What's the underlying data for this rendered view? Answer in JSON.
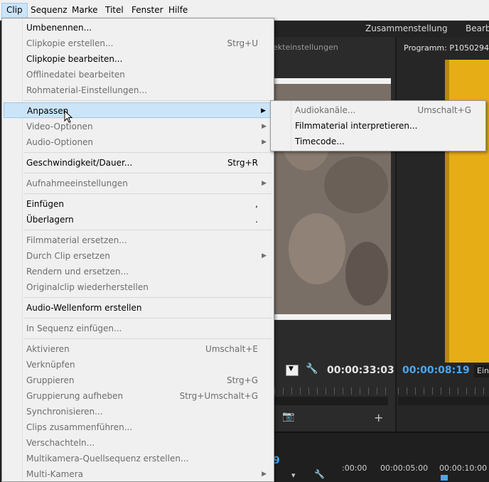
{
  "menubar": {
    "items": [
      {
        "label": "Clip",
        "active": true
      },
      {
        "label": "Sequenz"
      },
      {
        "label": "Marke"
      },
      {
        "label": "Titel"
      },
      {
        "label": "Fenster"
      },
      {
        "label": "Hilfe"
      }
    ]
  },
  "background": {
    "workspace_tabs": [
      "Zusammenstellung",
      "Bearbe"
    ],
    "source_panel_title": "ekteinstellungen",
    "program_panel_title": "Programm: P1050294",
    "source_timecode": "00:00:33:03",
    "program_timecode": "00:00:08:19",
    "program_fit_label": "Ein",
    "timeline_digit": "9",
    "timeline_ruler": [
      ":00:00",
      "00:00:05:00",
      "00:00:10:00"
    ]
  },
  "clip_menu": {
    "items": [
      {
        "label": "Umbenennen...",
        "shortcut": "",
        "enabled": true
      },
      {
        "label": "Clipkopie erstellen...",
        "shortcut": "Strg+U",
        "enabled": false
      },
      {
        "label": "Clipkopie bearbeiten...",
        "shortcut": "",
        "enabled": true
      },
      {
        "label": "Offlinedatei bearbeiten",
        "shortcut": "",
        "enabled": false
      },
      {
        "label": "Rohmaterial-Einstellungen...",
        "shortcut": "",
        "enabled": false
      },
      {
        "label": "Anpassen",
        "shortcut": "",
        "enabled": true,
        "submenu": true,
        "highlighted": true
      },
      {
        "label": "Video-Optionen",
        "shortcut": "",
        "enabled": false,
        "submenu": true
      },
      {
        "label": "Audio-Optionen",
        "shortcut": "",
        "enabled": false,
        "submenu": true
      },
      {
        "label": "Geschwindigkeit/Dauer...",
        "shortcut": "Strg+R",
        "enabled": true
      },
      {
        "label": "Aufnahmeeinstellungen",
        "shortcut": "",
        "enabled": false,
        "submenu": true
      },
      {
        "label": "Einfügen",
        "shortcut": ",",
        "enabled": true
      },
      {
        "label": "Überlagern",
        "shortcut": ".",
        "enabled": true
      },
      {
        "label": "Filmmaterial ersetzen...",
        "shortcut": "",
        "enabled": false
      },
      {
        "label": "Durch Clip ersetzen",
        "shortcut": "",
        "enabled": false,
        "submenu": true
      },
      {
        "label": "Rendern und ersetzen...",
        "shortcut": "",
        "enabled": false
      },
      {
        "label": "Originalclip wiederherstellen",
        "shortcut": "",
        "enabled": false
      },
      {
        "label": "Audio-Wellenform erstellen",
        "shortcut": "",
        "enabled": true
      },
      {
        "label": "In Sequenz einfügen...",
        "shortcut": "",
        "enabled": false
      },
      {
        "label": "Aktivieren",
        "shortcut": "Umschalt+E",
        "enabled": false
      },
      {
        "label": "Verknüpfen",
        "shortcut": "",
        "enabled": false
      },
      {
        "label": "Gruppieren",
        "shortcut": "Strg+G",
        "enabled": false
      },
      {
        "label": "Gruppierung aufheben",
        "shortcut": "Strg+Umschalt+G",
        "enabled": false
      },
      {
        "label": "Synchronisieren...",
        "shortcut": "",
        "enabled": false
      },
      {
        "label": "Clips zusammenführen...",
        "shortcut": "",
        "enabled": false
      },
      {
        "label": "Verschachteln...",
        "shortcut": "",
        "enabled": false
      },
      {
        "label": "Multikamera-Quellsequenz erstellen...",
        "shortcut": "",
        "enabled": false
      },
      {
        "label": "Multi-Kamera",
        "shortcut": "",
        "enabled": false,
        "submenu": true
      }
    ]
  },
  "submenu_anpassen": {
    "items": [
      {
        "label": "Audiokanäle...",
        "shortcut": "Umschalt+G",
        "enabled": false
      },
      {
        "label": "Filmmaterial interpretieren...",
        "shortcut": "",
        "enabled": true
      },
      {
        "label": "Timecode...",
        "shortcut": "",
        "enabled": true
      }
    ]
  },
  "colors": {
    "menu_bg": "#f0f0f0",
    "highlight_bg": "#cce4f7",
    "highlight_border": "#99c9ef",
    "timecode_blue": "#4aa7f0",
    "disabled_text": "#6d6d6d"
  }
}
